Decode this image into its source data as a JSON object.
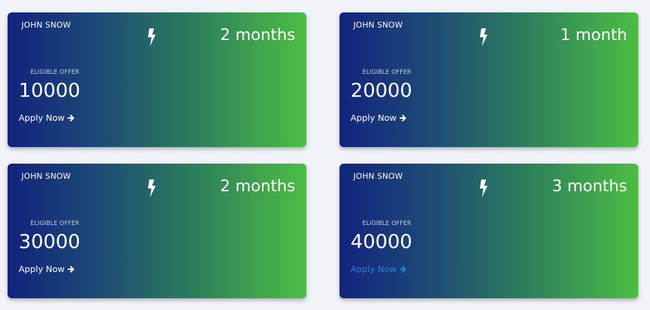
{
  "cards": [
    {
      "name": "JOHN SNOW",
      "duration": "2 months",
      "offer_label": "ELIGIBLE OFFER",
      "amount": "10000",
      "apply_label": "Apply Now",
      "icons": [
        "bolt-icon",
        "arrow-right-icon"
      ]
    },
    {
      "name": "JOHN SNOW",
      "duration": "1 month",
      "offer_label": "ELIGIBLE OFFER",
      "amount": "20000",
      "apply_label": "Apply Now",
      "icons": [
        "bolt-icon",
        "arrow-right-icon"
      ]
    },
    {
      "name": "JOHN SNOW",
      "duration": "2 months",
      "offer_label": "ELIGIBLE OFFER",
      "amount": "30000",
      "apply_label": "Apply Now",
      "icons": [
        "bolt-icon",
        "arrow-right-icon"
      ]
    },
    {
      "name": "JOHN SNOW",
      "duration": "3 months",
      "offer_label": "ELIGIBLE OFFER",
      "amount": "40000",
      "apply_label": "Apply Now",
      "icons": [
        "bolt-icon",
        "arrow-right-icon"
      ]
    }
  ],
  "colors": {
    "gradient_start": "#12237e",
    "gradient_end": "#4cbe43",
    "page_background": "#f0f3f7",
    "link_active": "#1e88d8"
  }
}
